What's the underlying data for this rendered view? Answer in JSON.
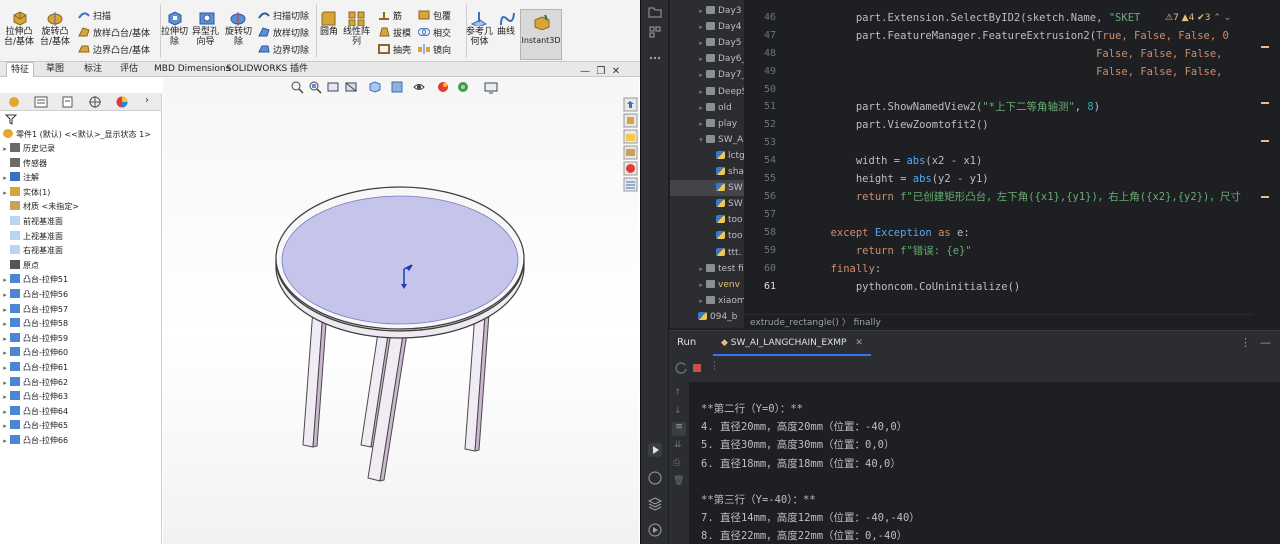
{
  "solidworks": {
    "ribbon": {
      "extrude_boss": "拉伸凸\n台/基体",
      "revolve_boss": "旋转凸\n台/基体",
      "sweep": "扫描",
      "loft_boss": "放样凸台/基体",
      "boundary_boss": "边界凸台/基体",
      "extrude_cut": "拉伸切\n除",
      "hole_wizard": "异型孔\n向导",
      "revolve_cut": "旋转切\n除",
      "sweep_cut": "扫描切除",
      "loft_cut": "放样切除",
      "boundary_cut": "边界切除",
      "fillet": "圆角",
      "linear_pattern": "线性阵\n列",
      "rib": "筋",
      "draft": "拔模",
      "shell": "抽壳",
      "wrap": "包覆",
      "intersect": "相交",
      "mirror": "镜向",
      "ref_geometry": "参考几\n何体",
      "curves": "曲线",
      "instant3d": "Instant3D"
    },
    "tabs": [
      "特征",
      "草图",
      "标注",
      "评估",
      "MBD Dimensions",
      "SOLIDWORKS 插件"
    ],
    "tree": {
      "root": "零件1 (默认) <<默认>_显示状态 1>",
      "items": [
        {
          "label": "历史记录",
          "arrow": "▸"
        },
        {
          "label": "传感器",
          "arrow": ""
        },
        {
          "label": "注解",
          "arrow": "▸"
        },
        {
          "label": "实体(1)",
          "arrow": "▸"
        },
        {
          "label": "材质 <未指定>",
          "arrow": ""
        },
        {
          "label": "前视基准面",
          "arrow": ""
        },
        {
          "label": "上视基准面",
          "arrow": ""
        },
        {
          "label": "右视基准面",
          "arrow": ""
        },
        {
          "label": "原点",
          "arrow": ""
        },
        {
          "label": "凸台-拉伸51",
          "arrow": "▸"
        },
        {
          "label": "凸台-拉伸56",
          "arrow": "▸"
        },
        {
          "label": "凸台-拉伸57",
          "arrow": "▸"
        },
        {
          "label": "凸台-拉伸58",
          "arrow": "▸"
        },
        {
          "label": "凸台-拉伸59",
          "arrow": "▸"
        },
        {
          "label": "凸台-拉伸60",
          "arrow": "▸"
        },
        {
          "label": "凸台-拉伸61",
          "arrow": "▸"
        },
        {
          "label": "凸台-拉伸62",
          "arrow": "▸"
        },
        {
          "label": "凸台-拉伸63",
          "arrow": "▸"
        },
        {
          "label": "凸台-拉伸64",
          "arrow": "▸"
        },
        {
          "label": "凸台-拉伸65",
          "arrow": "▸"
        },
        {
          "label": "凸台-拉伸66",
          "arrow": "▸"
        }
      ]
    }
  },
  "ide": {
    "project_tree": [
      {
        "label": "Day3",
        "arrow": "▸",
        "kind": "folder"
      },
      {
        "label": "Day4",
        "arrow": "▸",
        "kind": "folder"
      },
      {
        "label": "Day5",
        "arrow": "▸",
        "kind": "folder"
      },
      {
        "label": "Day6_",
        "arrow": "▸",
        "kind": "folder"
      },
      {
        "label": "Day7_",
        "arrow": "▸",
        "kind": "folder"
      },
      {
        "label": "DeepS",
        "arrow": "▸",
        "kind": "folder"
      },
      {
        "label": "old",
        "arrow": "▸",
        "kind": "folder"
      },
      {
        "label": "play",
        "arrow": "▸",
        "kind": "folder"
      },
      {
        "label": "SW_AI",
        "arrow": "▾",
        "kind": "folder"
      },
      {
        "label": "lctg",
        "arrow": "",
        "kind": "py"
      },
      {
        "label": "sha",
        "arrow": "",
        "kind": "py"
      },
      {
        "label": "SW",
        "arrow": "",
        "kind": "py"
      },
      {
        "label": "SW",
        "arrow": "",
        "kind": "py"
      },
      {
        "label": "too",
        "arrow": "",
        "kind": "py"
      },
      {
        "label": "too",
        "arrow": "",
        "kind": "py"
      },
      {
        "label": "ttt.",
        "arrow": "",
        "kind": "py"
      },
      {
        "label": "test fil",
        "arrow": "▸",
        "kind": "folder"
      },
      {
        "label": "venv",
        "arrow": "▸",
        "kind": "folder"
      },
      {
        "label": "xiaomi",
        "arrow": "▸",
        "kind": "folder"
      },
      {
        "label": "094_b",
        "arrow": "",
        "kind": "py"
      }
    ],
    "line_numbers": [
      "46",
      "47",
      "48",
      "49",
      "50",
      "51",
      "52",
      "53",
      "54",
      "55",
      "56",
      "57",
      "58",
      "59",
      "60",
      "61"
    ],
    "code": {
      "l46_a": "            part.Extension.SelectByID2(sketch.Name, ",
      "l46_b": "\"SKET",
      "l47_a": "            part.FeatureManager.FeatureExtrusion2(",
      "l47_b": "True, False, False, 0",
      "l48": "                                                  False, False, False,",
      "l49": "                                                  False, False, False,",
      "l51_a": "            part.ShowNamedView2(",
      "l51_b": "\"*上下二等角轴测\"",
      "l51_c": ", ",
      "l51_d": "8",
      "l51_e": ")",
      "l52": "            part.ViewZoomtofit2()",
      "l54_a": "            width = ",
      "l54_b": "abs",
      "l54_c": "(x2 - x1)",
      "l55_a": "            height = ",
      "l55_b": "abs",
      "l55_c": "(y2 - y1)",
      "l56_a": "            ",
      "l56_b": "return ",
      "l56_c": "f\"已创建矩形凸台，左下角({x1},{y1})，右上角({x2},{y2})，尺寸",
      "l58_a": "        ",
      "l58_b": "except ",
      "l58_c": "Exception ",
      "l58_d": "as ",
      "l58_e": "e:",
      "l59_a": "            ",
      "l59_b": "return ",
      "l59_c": "f\"错误: {e}\"",
      "l60_a": "        ",
      "l60_b": "finally",
      "l60_c": ":",
      "l61": "            pythoncom.CoUninitialize()"
    },
    "inspections": "⚠7  ▲4  ✔3",
    "breadcrumbs": "extrude_rectangle()  〉 finally",
    "run": {
      "tab_run": "Run",
      "config": "SW_AI_LANGCHAIN_EXMP"
    },
    "console": [
      "**第二行（Y=0）：**",
      "4. 直径20mm，高度20mm（位置：-40,0）",
      "5. 直径30mm，高度30mm（位置：0,0）",
      "6. 直径18mm，高度18mm（位置：40,0）",
      "",
      "**第三行（Y=-40）：**",
      "7. 直径14mm，高度12mm（位置：-40,-40）",
      "8. 直径22mm，高度22mm（位置：0,-40）"
    ]
  }
}
